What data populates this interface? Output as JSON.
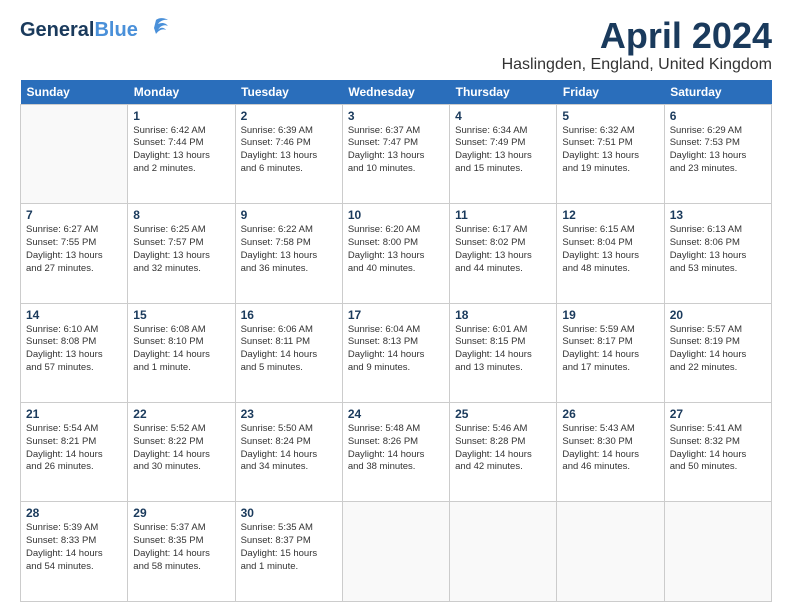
{
  "logo": {
    "general": "General",
    "blue": "Blue",
    "tagline": "▶"
  },
  "header": {
    "title": "April 2024",
    "location": "Haslingden, England, United Kingdom"
  },
  "days_of_week": [
    "Sunday",
    "Monday",
    "Tuesday",
    "Wednesday",
    "Thursday",
    "Friday",
    "Saturday"
  ],
  "weeks": [
    [
      {
        "day": "",
        "info": ""
      },
      {
        "day": "1",
        "info": "Sunrise: 6:42 AM\nSunset: 7:44 PM\nDaylight: 13 hours\nand 2 minutes."
      },
      {
        "day": "2",
        "info": "Sunrise: 6:39 AM\nSunset: 7:46 PM\nDaylight: 13 hours\nand 6 minutes."
      },
      {
        "day": "3",
        "info": "Sunrise: 6:37 AM\nSunset: 7:47 PM\nDaylight: 13 hours\nand 10 minutes."
      },
      {
        "day": "4",
        "info": "Sunrise: 6:34 AM\nSunset: 7:49 PM\nDaylight: 13 hours\nand 15 minutes."
      },
      {
        "day": "5",
        "info": "Sunrise: 6:32 AM\nSunset: 7:51 PM\nDaylight: 13 hours\nand 19 minutes."
      },
      {
        "day": "6",
        "info": "Sunrise: 6:29 AM\nSunset: 7:53 PM\nDaylight: 13 hours\nand 23 minutes."
      }
    ],
    [
      {
        "day": "7",
        "info": "Sunrise: 6:27 AM\nSunset: 7:55 PM\nDaylight: 13 hours\nand 27 minutes."
      },
      {
        "day": "8",
        "info": "Sunrise: 6:25 AM\nSunset: 7:57 PM\nDaylight: 13 hours\nand 32 minutes."
      },
      {
        "day": "9",
        "info": "Sunrise: 6:22 AM\nSunset: 7:58 PM\nDaylight: 13 hours\nand 36 minutes."
      },
      {
        "day": "10",
        "info": "Sunrise: 6:20 AM\nSunset: 8:00 PM\nDaylight: 13 hours\nand 40 minutes."
      },
      {
        "day": "11",
        "info": "Sunrise: 6:17 AM\nSunset: 8:02 PM\nDaylight: 13 hours\nand 44 minutes."
      },
      {
        "day": "12",
        "info": "Sunrise: 6:15 AM\nSunset: 8:04 PM\nDaylight: 13 hours\nand 48 minutes."
      },
      {
        "day": "13",
        "info": "Sunrise: 6:13 AM\nSunset: 8:06 PM\nDaylight: 13 hours\nand 53 minutes."
      }
    ],
    [
      {
        "day": "14",
        "info": "Sunrise: 6:10 AM\nSunset: 8:08 PM\nDaylight: 13 hours\nand 57 minutes."
      },
      {
        "day": "15",
        "info": "Sunrise: 6:08 AM\nSunset: 8:10 PM\nDaylight: 14 hours\nand 1 minute."
      },
      {
        "day": "16",
        "info": "Sunrise: 6:06 AM\nSunset: 8:11 PM\nDaylight: 14 hours\nand 5 minutes."
      },
      {
        "day": "17",
        "info": "Sunrise: 6:04 AM\nSunset: 8:13 PM\nDaylight: 14 hours\nand 9 minutes."
      },
      {
        "day": "18",
        "info": "Sunrise: 6:01 AM\nSunset: 8:15 PM\nDaylight: 14 hours\nand 13 minutes."
      },
      {
        "day": "19",
        "info": "Sunrise: 5:59 AM\nSunset: 8:17 PM\nDaylight: 14 hours\nand 17 minutes."
      },
      {
        "day": "20",
        "info": "Sunrise: 5:57 AM\nSunset: 8:19 PM\nDaylight: 14 hours\nand 22 minutes."
      }
    ],
    [
      {
        "day": "21",
        "info": "Sunrise: 5:54 AM\nSunset: 8:21 PM\nDaylight: 14 hours\nand 26 minutes."
      },
      {
        "day": "22",
        "info": "Sunrise: 5:52 AM\nSunset: 8:22 PM\nDaylight: 14 hours\nand 30 minutes."
      },
      {
        "day": "23",
        "info": "Sunrise: 5:50 AM\nSunset: 8:24 PM\nDaylight: 14 hours\nand 34 minutes."
      },
      {
        "day": "24",
        "info": "Sunrise: 5:48 AM\nSunset: 8:26 PM\nDaylight: 14 hours\nand 38 minutes."
      },
      {
        "day": "25",
        "info": "Sunrise: 5:46 AM\nSunset: 8:28 PM\nDaylight: 14 hours\nand 42 minutes."
      },
      {
        "day": "26",
        "info": "Sunrise: 5:43 AM\nSunset: 8:30 PM\nDaylight: 14 hours\nand 46 minutes."
      },
      {
        "day": "27",
        "info": "Sunrise: 5:41 AM\nSunset: 8:32 PM\nDaylight: 14 hours\nand 50 minutes."
      }
    ],
    [
      {
        "day": "28",
        "info": "Sunrise: 5:39 AM\nSunset: 8:33 PM\nDaylight: 14 hours\nand 54 minutes."
      },
      {
        "day": "29",
        "info": "Sunrise: 5:37 AM\nSunset: 8:35 PM\nDaylight: 14 hours\nand 58 minutes."
      },
      {
        "day": "30",
        "info": "Sunrise: 5:35 AM\nSunset: 8:37 PM\nDaylight: 15 hours\nand 1 minute."
      },
      {
        "day": "",
        "info": ""
      },
      {
        "day": "",
        "info": ""
      },
      {
        "day": "",
        "info": ""
      },
      {
        "day": "",
        "info": ""
      }
    ]
  ]
}
